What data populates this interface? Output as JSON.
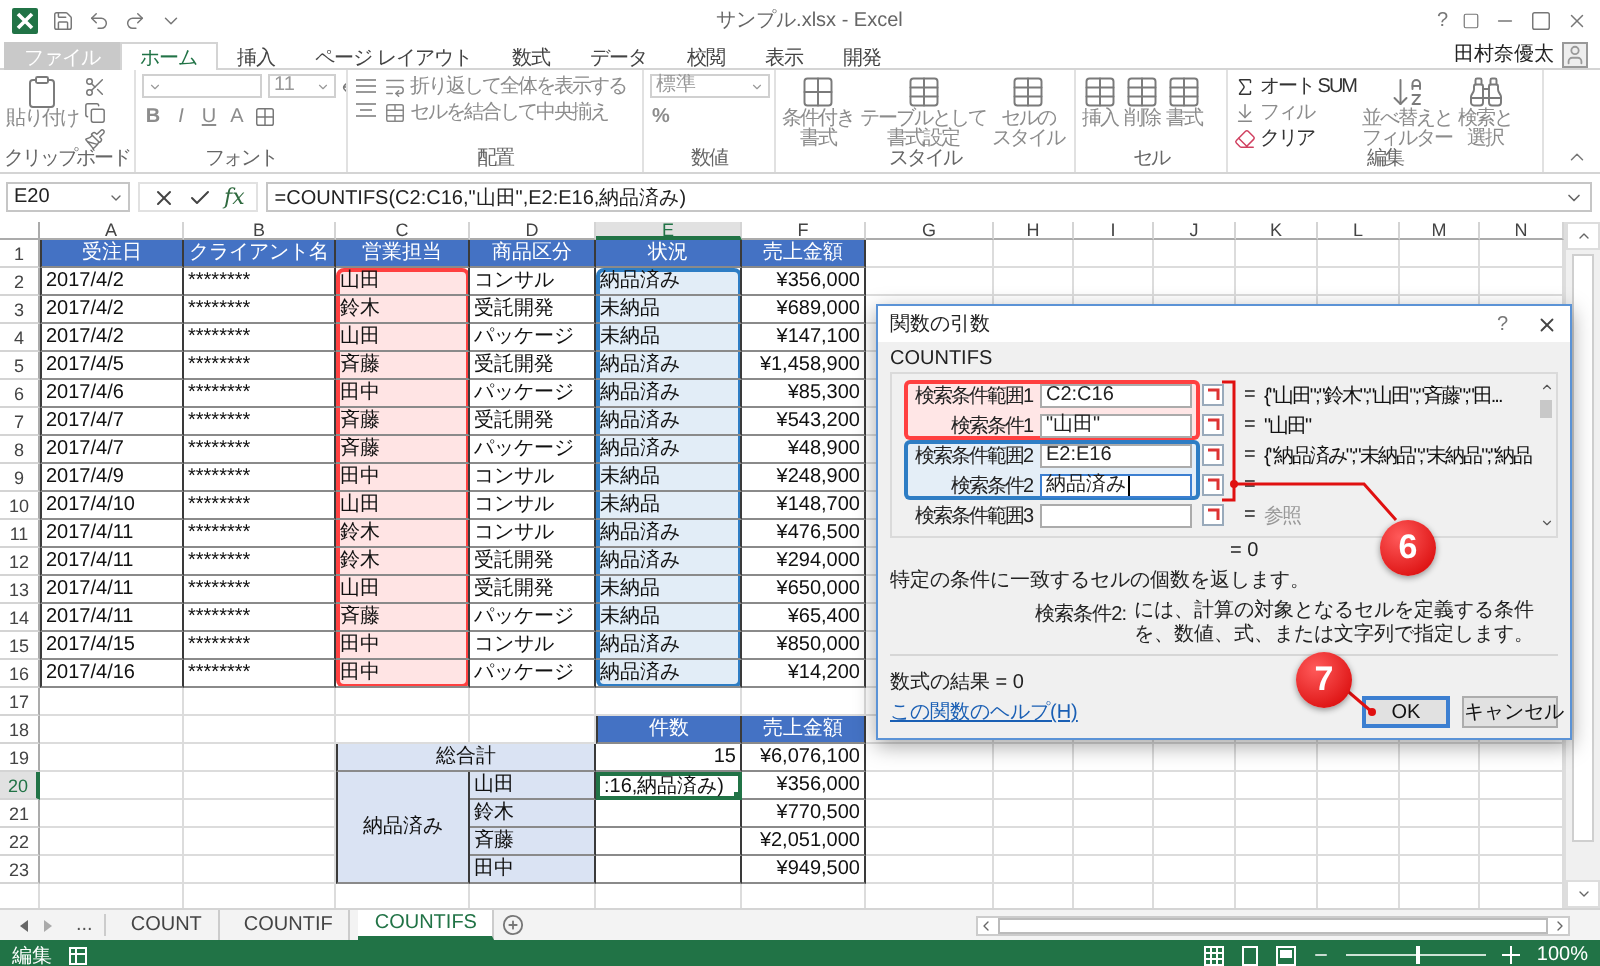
{
  "window": {
    "title": "サンプル.xlsx - Excel",
    "help": "?",
    "user": "田村奈優太"
  },
  "ribbon_tabs": [
    {
      "label": "ファイル",
      "kind": "file",
      "selected": false
    },
    {
      "label": "ホーム",
      "kind": "tab",
      "selected": true
    },
    {
      "label": "挿入",
      "kind": "tab",
      "selected": false
    },
    {
      "label": "ページ レイアウト",
      "kind": "tab",
      "selected": false
    },
    {
      "label": "数式",
      "kind": "tab",
      "selected": false
    },
    {
      "label": "データ",
      "kind": "tab",
      "selected": false
    },
    {
      "label": "校閲",
      "kind": "tab",
      "selected": false
    },
    {
      "label": "表示",
      "kind": "tab",
      "selected": false
    },
    {
      "label": "開発",
      "kind": "tab",
      "selected": false
    }
  ],
  "ribbon_groups": [
    {
      "label": "クリップボード",
      "items": [
        {
          "kind": "large",
          "lines": [
            "貼り付け"
          ],
          "disabled": true
        }
      ]
    },
    {
      "label": "フォント",
      "items": [
        {
          "kind": "field",
          "disabled": true
        },
        {
          "kind": "field",
          "value": "11",
          "disabled": true
        },
        {
          "kind": "glyph",
          "label": "B",
          "disabled": true
        },
        {
          "kind": "glyph",
          "label": "I",
          "disabled": true
        },
        {
          "kind": "glyph",
          "label": "U",
          "disabled": true
        },
        {
          "kind": "glyph",
          "label": "A",
          "disabled": true
        }
      ]
    },
    {
      "label": "配置",
      "items": [
        {
          "kind": "small",
          "label": "折り返して全体を表示する",
          "disabled": true
        },
        {
          "kind": "small",
          "label": "セルを結合して中央揃え",
          "disabled": true
        }
      ]
    },
    {
      "label": "数値",
      "items": [
        {
          "kind": "field",
          "value": "標準",
          "disabled": true
        },
        {
          "kind": "glyph",
          "label": "%",
          "disabled": true
        }
      ]
    },
    {
      "label": "スタイル",
      "items": [
        {
          "kind": "large",
          "lines": [
            "条件付き",
            "書式"
          ],
          "disabled": true
        },
        {
          "kind": "large",
          "lines": [
            "テーブルとして",
            "書式設定"
          ],
          "disabled": true
        },
        {
          "kind": "large",
          "lines": [
            "セルの",
            "スタイル"
          ],
          "disabled": true
        }
      ]
    },
    {
      "label": "セル",
      "items": [
        {
          "kind": "large",
          "lines": [
            "挿入"
          ],
          "disabled": true
        },
        {
          "kind": "large",
          "lines": [
            "削除"
          ],
          "disabled": true
        },
        {
          "kind": "large",
          "lines": [
            "書式"
          ],
          "disabled": true
        }
      ]
    },
    {
      "label": "編集",
      "items": [
        {
          "kind": "small",
          "label": "オート SUM",
          "disabled": false
        },
        {
          "kind": "small",
          "label": "フィル",
          "disabled": true
        },
        {
          "kind": "small",
          "label": "クリア",
          "disabled": false
        },
        {
          "kind": "large",
          "lines": [
            "並べ替えと",
            "フィルター"
          ],
          "disabled": true
        },
        {
          "kind": "large",
          "lines": [
            "検索と",
            "選択"
          ],
          "disabled": true
        }
      ]
    }
  ],
  "formula_bar": {
    "name_box": "E20",
    "fx": "fx",
    "formula": "=COUNTIFS(C2:C16,\"山田\",E2:E16,納品済み)"
  },
  "sheet": {
    "columns": [
      {
        "letter": "A",
        "selected": false
      },
      {
        "letter": "B",
        "selected": false
      },
      {
        "letter": "C",
        "selected": false
      },
      {
        "letter": "D",
        "selected": false
      },
      {
        "letter": "E",
        "selected": true
      },
      {
        "letter": "F",
        "selected": false
      },
      {
        "letter": "G",
        "selected": false
      },
      {
        "letter": "H",
        "selected": false
      },
      {
        "letter": "I",
        "selected": false
      },
      {
        "letter": "J",
        "selected": false
      },
      {
        "letter": "K",
        "selected": false
      },
      {
        "letter": "L",
        "selected": false
      },
      {
        "letter": "M",
        "selected": false
      },
      {
        "letter": "N",
        "selected": false
      }
    ],
    "row_numbers": [
      {
        "label": "1",
        "selected": false
      },
      {
        "label": "2",
        "selected": false
      },
      {
        "label": "3",
        "selected": false
      },
      {
        "label": "4",
        "selected": false
      },
      {
        "label": "5",
        "selected": false
      },
      {
        "label": "6",
        "selected": false
      },
      {
        "label": "7",
        "selected": false
      },
      {
        "label": "8",
        "selected": false
      },
      {
        "label": "9",
        "selected": false
      },
      {
        "label": "10",
        "selected": false
      },
      {
        "label": "11",
        "selected": false
      },
      {
        "label": "12",
        "selected": false
      },
      {
        "label": "13",
        "selected": false
      },
      {
        "label": "14",
        "selected": false
      },
      {
        "label": "15",
        "selected": false
      },
      {
        "label": "16",
        "selected": false
      },
      {
        "label": "17",
        "selected": false
      },
      {
        "label": "18",
        "selected": false
      },
      {
        "label": "19",
        "selected": false
      },
      {
        "label": "20",
        "selected": true
      },
      {
        "label": "21",
        "selected": false
      },
      {
        "label": "22",
        "selected": false
      },
      {
        "label": "23",
        "selected": false
      }
    ]
  },
  "data_table": {
    "columns": [
      {
        "label": "受注日"
      },
      {
        "label": "クライアント名"
      },
      {
        "label": "営業担当",
        "color": "#ff4040"
      },
      {
        "label": "商品区分"
      },
      {
        "label": "状況",
        "color": "#2e7dc4"
      },
      {
        "label": "売上金額"
      }
    ],
    "rows": [
      [
        "2017/4/2",
        "********",
        "山田",
        "コンサル",
        "納品済み",
        "¥356,000"
      ],
      [
        "2017/4/2",
        "********",
        "鈴木",
        "受託開発",
        "未納品",
        "¥689,000"
      ],
      [
        "2017/4/2",
        "********",
        "山田",
        "パッケージ",
        "未納品",
        "¥147,100"
      ],
      [
        "2017/4/5",
        "********",
        "斉藤",
        "受託開発",
        "納品済み",
        "¥1,458,900"
      ],
      [
        "2017/4/6",
        "********",
        "田中",
        "パッケージ",
        "納品済み",
        "¥85,300"
      ],
      [
        "2017/4/7",
        "********",
        "斉藤",
        "受託開発",
        "納品済み",
        "¥543,200"
      ],
      [
        "2017/4/7",
        "********",
        "斉藤",
        "パッケージ",
        "納品済み",
        "¥48,900"
      ],
      [
        "2017/4/9",
        "********",
        "田中",
        "コンサル",
        "未納品",
        "¥248,900"
      ],
      [
        "2017/4/10",
        "********",
        "山田",
        "コンサル",
        "未納品",
        "¥148,700"
      ],
      [
        "2017/4/11",
        "********",
        "鈴木",
        "コンサル",
        "納品済み",
        "¥476,500"
      ],
      [
        "2017/4/11",
        "********",
        "鈴木",
        "受託開発",
        "納品済み",
        "¥294,000"
      ],
      [
        "2017/4/11",
        "********",
        "山田",
        "受託開発",
        "未納品",
        "¥650,000"
      ],
      [
        "2017/4/11",
        "********",
        "斉藤",
        "パッケージ",
        "未納品",
        "¥65,400"
      ],
      [
        "2017/4/15",
        "********",
        "田中",
        "コンサル",
        "納品済み",
        "¥850,000"
      ],
      [
        "2017/4/16",
        "********",
        "田中",
        "パッケージ",
        "納品済み",
        "¥14,200"
      ]
    ]
  },
  "summary": {
    "headers": [
      "件数",
      "売上金額"
    ],
    "total": {
      "label": "総合計",
      "count": "15",
      "amount": "¥6,076,100"
    },
    "group": {
      "label": "納品済み",
      "rows": [
        {
          "name": "山田",
          "count": ":16,納品済み)",
          "amount": "¥356,000",
          "selected": true
        },
        {
          "name": "鈴木",
          "amount": "¥770,500",
          "selected": false
        },
        {
          "name": "斉藤",
          "amount": "¥2,051,000",
          "selected": false
        },
        {
          "name": "田中",
          "amount": "¥949,500",
          "selected": false
        }
      ]
    }
  },
  "dialog": {
    "title": "関数の引数",
    "help": "?",
    "function": "COUNTIFS",
    "args": [
      {
        "label": "検索条件範囲1",
        "value": "C2:C16",
        "eq": "=",
        "result": "{\"山田\";\"鈴木\";\"山田\";\"斉藤\";\"田...",
        "color": "#ff4040",
        "focused": false
      },
      {
        "label": "検索条件1",
        "value": "\"山田\"",
        "eq": "=",
        "result": "\"山田\"",
        "color": "#ff4040",
        "focused": false
      },
      {
        "label": "検索条件範囲2",
        "value": "E2:E16",
        "eq": "=",
        "result": "{\"納品済み\";\"未納品\";\"未納品\";\"納品",
        "color": "#2e7dc4",
        "focused": false
      },
      {
        "label": "検索条件2",
        "value": "納品済み",
        "eq": "=",
        "color": "#2e7dc4",
        "focused": true
      },
      {
        "label": "検索条件範囲3",
        "eq": "=",
        "hint": "参照",
        "focused": false
      }
    ],
    "total": "= 0",
    "description": "特定の条件に一致するセルの個数を返します。",
    "arg_help": {
      "label": "検索条件2:",
      "text": "には、計算の対象となるセルを定義する条件を、数値、式、または文字列で指定します。"
    },
    "formula_result": "数式の結果 =  0",
    "help_link": "この関数のヘルプ(H)",
    "buttons": [
      {
        "label": "OK",
        "kind": "default"
      },
      {
        "label": "キャンセル",
        "kind": "normal"
      }
    ]
  },
  "callouts": [
    {
      "label": "6"
    },
    {
      "label": "7"
    }
  ],
  "sheet_tabs": {
    "overflow": "...",
    "tabs": [
      {
        "label": "COUNT",
        "selected": false
      },
      {
        "label": "COUNTIF",
        "selected": false
      },
      {
        "label": "COUNTIFS",
        "selected": true
      }
    ]
  },
  "status_bar": {
    "mode": "編集",
    "zoom": {
      "level": 0.5,
      "reading": "100%"
    }
  }
}
